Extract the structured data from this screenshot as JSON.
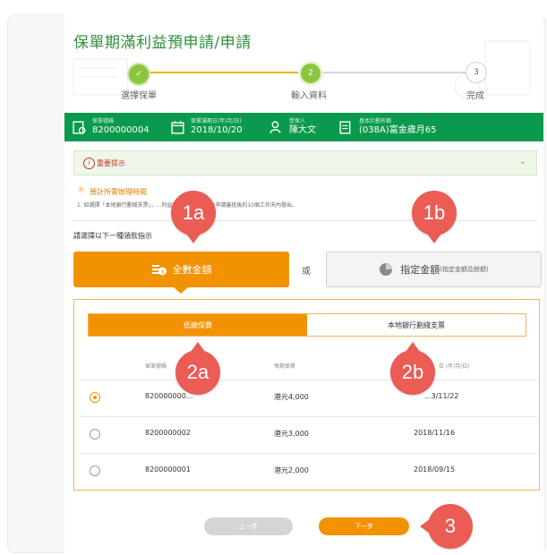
{
  "title": "保單期滿利益預申請/申請",
  "steps": [
    {
      "number": "✓",
      "label": "選擇保單"
    },
    {
      "number": "2",
      "label": "輸入資料"
    },
    {
      "number": "3",
      "label": "完成"
    }
  ],
  "info": [
    {
      "icon": "policy-doc-icon",
      "label": "保單號碼",
      "value": "8200000004"
    },
    {
      "icon": "calendar-icon",
      "label": "保單滿期日(年/月/日)",
      "value": "2018/10/20"
    },
    {
      "icon": "person-icon",
      "label": "受保人",
      "value": "陳大文"
    },
    {
      "icon": "plan-icon",
      "label": "基本計劃名稱",
      "value": "(038A)富金歲月65"
    }
  ],
  "notice": {
    "title": "重要提示"
  },
  "tip": {
    "title": "預計所需辦理時間",
    "text": "1. 如選擇「本地銀行劃綫支票」，...利益將於保單滿期日及申請審批後的10個工作天內發出。"
  },
  "choose_label": "請選擇以下一種領款指示",
  "options": {
    "full": "全數金額",
    "or": "或",
    "specified": "指定金額",
    "specified_note": "(指定金額及餘額)"
  },
  "tabs": {
    "left": "低繳保費",
    "right": "本地銀行劃綫支票"
  },
  "table": {
    "headers": [
      "保單號碼",
      "每期保費",
      "日 (年/月/日)"
    ],
    "rows": [
      {
        "selected": true,
        "policy": "820000000...",
        "amount": "港元4,000",
        "date": "...3/11/22"
      },
      {
        "selected": false,
        "policy": "8200000002",
        "amount": "港元3,000",
        "date": "2018/11/16"
      },
      {
        "selected": false,
        "policy": "8200000001",
        "amount": "港元2,000",
        "date": "2018/09/15"
      }
    ]
  },
  "buttons": {
    "prev": "上一步",
    "next": "下一步"
  },
  "markers": {
    "m1a": "1a",
    "m1b": "1b",
    "m2a": "2a",
    "m2b": "2b",
    "m3": "3"
  },
  "colors": {
    "green": "#0b9a4d",
    "orange": "#f39200",
    "marker": "#ea5c54"
  }
}
